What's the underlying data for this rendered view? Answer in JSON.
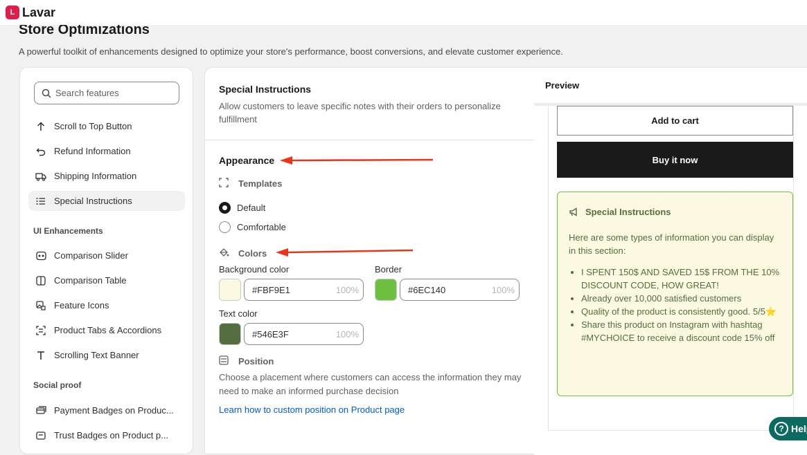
{
  "app": {
    "name": "Lavar",
    "logo_letter": "L"
  },
  "page": {
    "title": "Store Optimizations",
    "subtitle": "A powerful toolkit of enhancements designed to optimize your store's performance, boost conversions, and elevate customer experience."
  },
  "sidebar": {
    "search_placeholder": "Search features",
    "items": [
      {
        "label": "Scroll to Top Button",
        "icon": "arrow-up-icon"
      },
      {
        "label": "Refund Information",
        "icon": "return-icon"
      },
      {
        "label": "Shipping Information",
        "icon": "truck-icon"
      },
      {
        "label": "Special Instructions",
        "icon": "list-icon",
        "active": true
      }
    ],
    "section_ui": "UI Enhancements",
    "ui_items": [
      {
        "label": "Comparison Slider",
        "icon": "compare-icon"
      },
      {
        "label": "Comparison Table",
        "icon": "columns-icon"
      },
      {
        "label": "Feature Icons",
        "icon": "image-icon"
      },
      {
        "label": "Product Tabs & Accordions",
        "icon": "tabs-icon"
      },
      {
        "label": "Scrolling Text Banner",
        "icon": "text-icon"
      }
    ],
    "section_social": "Social proof",
    "social_items": [
      {
        "label": "Payment Badges on Produc...",
        "icon": "card-icon"
      },
      {
        "label": "Trust Badges on Product p...",
        "icon": "badge-icon"
      }
    ]
  },
  "settings": {
    "title": "Special Instructions",
    "description": "Allow customers to leave specific notes with their orders to personalize fulfillment",
    "appearance": "Appearance",
    "templates_label": "Templates",
    "template_options": [
      "Default",
      "Comfortable"
    ],
    "template_selected": "Default",
    "colors_label": "Colors",
    "bg_color": {
      "label": "Background color",
      "value": "#FBF9E1",
      "opacity": "100%"
    },
    "border_color": {
      "label": "Border",
      "value": "#6EC140",
      "opacity": "100%"
    },
    "text_color": {
      "label": "Text color",
      "value": "#546E3F",
      "opacity": "100%"
    },
    "position_label": "Position",
    "position_desc": "Choose a placement where customers can access the information they may need to make an informed purchase decision",
    "learn_link": "Learn how to custom position on Product page"
  },
  "preview": {
    "heading": "Preview",
    "add_to_cart": "Add to cart",
    "buy_now": "Buy it now",
    "box_title": "Special Instructions",
    "intro": "Here are some types of information you can display in this section:",
    "bullets": [
      "I SPENT 150$ AND SAVED 15$ FROM THE 10% DISCOUNT CODE, HOW GREAT!",
      "Already over 10,000 satisfied customers",
      "Quality of the product is consistently good. 5/5⭐",
      "Share this product on Instagram with hashtag #MYCHOICE to receive a discount code 15% off"
    ]
  },
  "help": {
    "label": "Help"
  },
  "colors": {
    "arrow": "#e8351e",
    "link": "#005bd3",
    "logo": "#e11d48"
  }
}
